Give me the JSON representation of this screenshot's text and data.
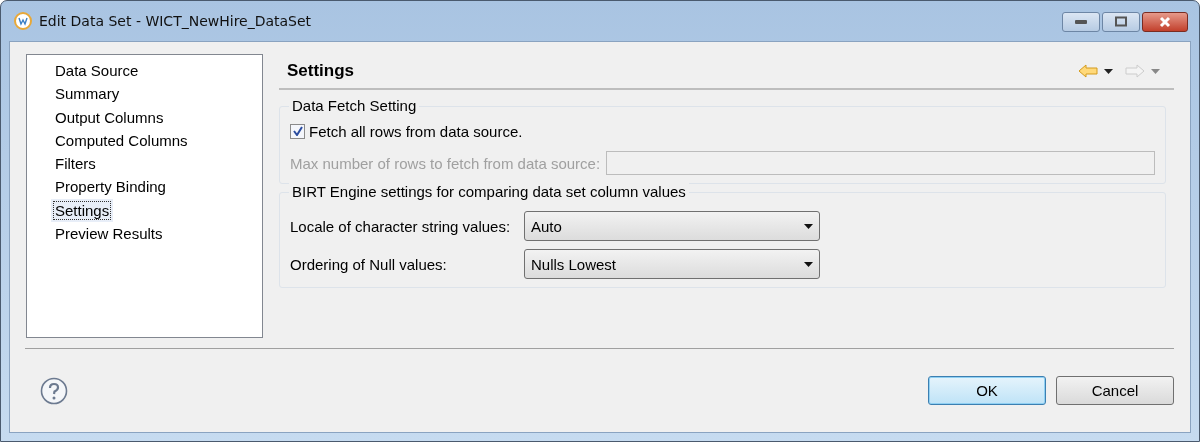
{
  "window": {
    "title": "Edit Data Set - WICT_NewHire_DataSet"
  },
  "sidebar": {
    "items": [
      {
        "label": "Data Source",
        "selected": false
      },
      {
        "label": "Summary",
        "selected": false
      },
      {
        "label": "Output Columns",
        "selected": false
      },
      {
        "label": "Computed Columns",
        "selected": false
      },
      {
        "label": "Filters",
        "selected": false
      },
      {
        "label": "Property Binding",
        "selected": false
      },
      {
        "label": "Settings",
        "selected": true
      },
      {
        "label": "Preview Results",
        "selected": false
      }
    ]
  },
  "page": {
    "title": "Settings",
    "nav": [
      {
        "kind": "back",
        "disabled": false
      },
      {
        "kind": "forward",
        "disabled": true
      }
    ]
  },
  "groups": [
    {
      "title": "Data Fetch Setting",
      "rows": [
        {
          "kind": "checkbox",
          "label": "Fetch all rows from data source.",
          "checked": true
        },
        {
          "kind": "field",
          "label": "Max number of rows to fetch from data source:",
          "disabled": true
        }
      ]
    },
    {
      "title": "BIRT Engine settings for comparing data set column values",
      "rows": [
        {
          "kind": "dropdown",
          "label": "Locale of character string values:",
          "value": "Auto"
        },
        {
          "kind": "dropdown",
          "label": "Ordering of Null values:",
          "value": "Nulls Lowest"
        }
      ]
    }
  ],
  "buttons": [
    {
      "label": "OK",
      "default": true
    },
    {
      "label": "Cancel",
      "default": false
    }
  ]
}
